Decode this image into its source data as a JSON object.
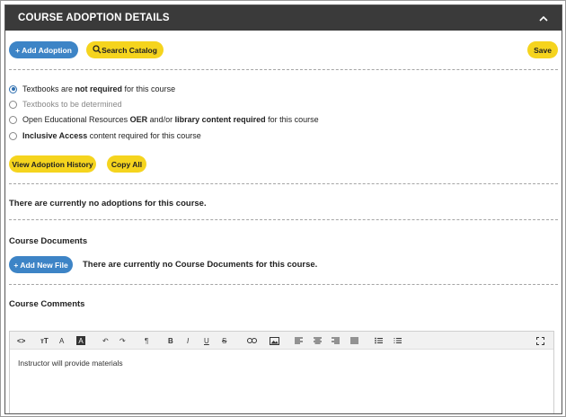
{
  "header": {
    "title": "COURSE ADOPTION DETAILS",
    "caret_icon": "chevron-up-icon"
  },
  "actions": {
    "add_adoption": "+ Add Adoption",
    "search_catalog": "Search Catalog",
    "save": "Save"
  },
  "options": [
    {
      "pre": "Textbooks are ",
      "bold": "not required",
      "post": " for this course",
      "checked": true
    },
    {
      "pre": "Textbooks ",
      "bold": "",
      "post": "to be determined",
      "checked": false,
      "muted": true
    },
    {
      "pre": "Open Educational Resources ",
      "bold": "OER",
      "mid": " and/or ",
      "bold2": "library content required",
      "post": " for this course",
      "checked": false
    },
    {
      "pre": "",
      "bold": "Inclusive Access",
      "post": " content required for this course",
      "checked": false
    }
  ],
  "history": {
    "view_history": "View Adoption History",
    "copy_all": "Copy All"
  },
  "adoptions": {
    "empty_message": "There are currently no adoptions for this course."
  },
  "documents": {
    "title": "Course Documents",
    "add_file": "+ Add New File",
    "empty_message": "There are currently no Course Documents for this course."
  },
  "comments": {
    "title": "Course Comments",
    "content": "Instructor will provide materials"
  },
  "colors": {
    "header_bg": "#3a3a3a",
    "blue": "#3d84c6",
    "yellow": "#f5d41e"
  }
}
